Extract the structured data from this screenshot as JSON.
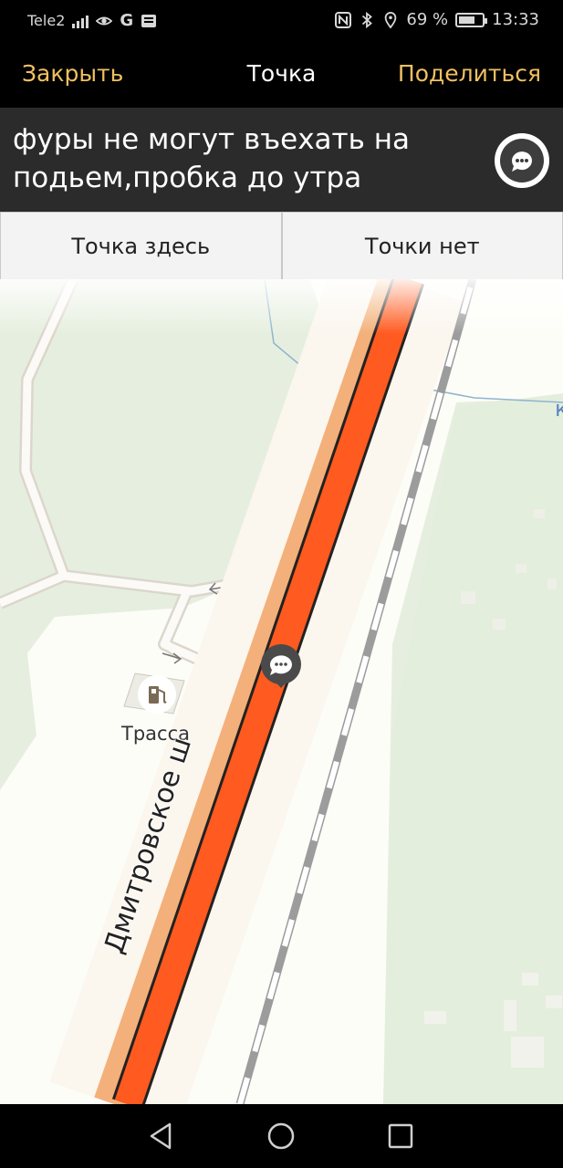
{
  "status_bar": {
    "carrier": "Tele2",
    "battery_percent": "69 %",
    "battery_level": 0.69,
    "time": "13:33",
    "icons": [
      "signal-icon",
      "eye-icon",
      "google-icon",
      "news-icon",
      "nfc-icon",
      "bluetooth-icon",
      "location-icon",
      "battery-icon"
    ]
  },
  "header": {
    "close_label": "Закрыть",
    "title": "Точка",
    "share_label": "Поделиться"
  },
  "message": {
    "text": "фуры не могут въехать на подьем,пробка до утра"
  },
  "actions": {
    "here_label": "Точка здесь",
    "not_here_label": "Точки нет"
  },
  "map": {
    "road_name": "Дмитровское ш",
    "poi_name": "Трасса",
    "colors": {
      "land": "#e6efdf",
      "traffic": "#ff5a1f",
      "road_edge": "#f3b07a",
      "accent": "#f0c060"
    }
  },
  "nav_bar": {
    "icons": [
      "back-icon",
      "home-icon",
      "recents-icon"
    ]
  }
}
